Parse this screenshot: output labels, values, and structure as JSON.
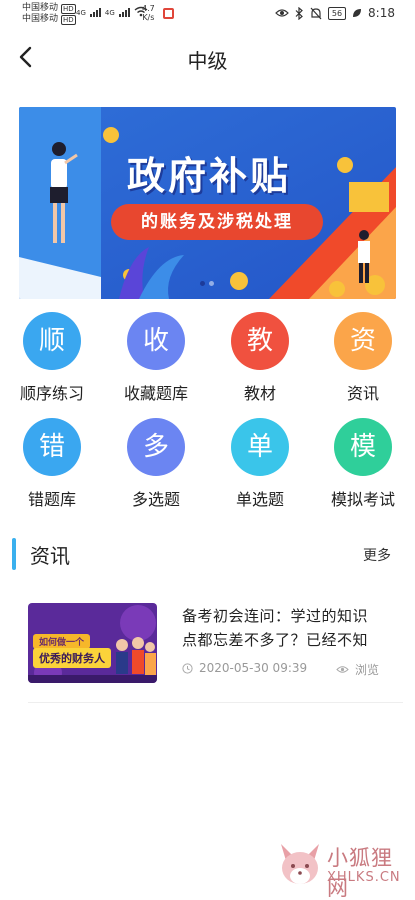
{
  "status_bar": {
    "carrier_1": "中国移动",
    "carrier_2": "中国移动",
    "hd_badge": "HD",
    "network_1": "4G",
    "network_2": "4G",
    "speed_value": "4.7",
    "speed_unit": "K/s",
    "battery": "56",
    "time": "8:18"
  },
  "header": {
    "title": "中级"
  },
  "banner": {
    "title": "政府补贴",
    "subtitle": "的账务及涉税处理",
    "slide_count": 2,
    "active_slide": 1
  },
  "grid": [
    {
      "glyph": "顺",
      "label": "顺序练习",
      "color": "#3aa7f0"
    },
    {
      "glyph": "收",
      "label": "收藏题库",
      "color": "#6b85f2"
    },
    {
      "glyph": "教",
      "label": "教材",
      "color": "#f0513f"
    },
    {
      "glyph": "资",
      "label": "资讯",
      "color": "#fba54a"
    },
    {
      "glyph": "错",
      "label": "错题库",
      "color": "#3aa7f0"
    },
    {
      "glyph": "多",
      "label": "多选题",
      "color": "#6b85f2"
    },
    {
      "glyph": "单",
      "label": "单选题",
      "color": "#3ac5ea"
    },
    {
      "glyph": "模",
      "label": "模拟考试",
      "color": "#2fcf9a"
    }
  ],
  "news": {
    "section_title": "资讯",
    "more_label": "更多",
    "items": [
      {
        "thumb_tag": "如何做一个",
        "thumb_text": "优秀的财务人",
        "headline": "备考初会连问：学过的知识点都忘差不多了？已经不知",
        "datetime": "2020-05-30 09:39",
        "views_label": "浏览"
      }
    ]
  },
  "watermark": {
    "name_cn": "小狐狸网",
    "name_en": "XHLKS.CN"
  }
}
